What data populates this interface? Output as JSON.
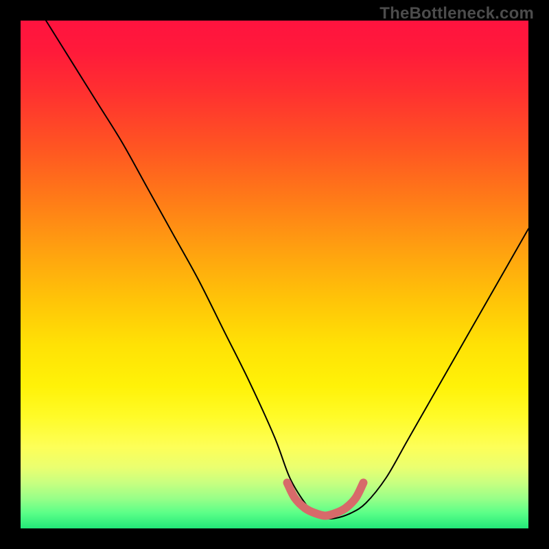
{
  "watermark": "TheBottleneck.com",
  "chart_data": {
    "type": "line",
    "title": "",
    "xlabel": "",
    "ylabel": "",
    "xlim": [
      0,
      100
    ],
    "ylim": [
      0,
      100
    ],
    "grid": false,
    "series": [
      {
        "name": "main-curve",
        "color": "#000000",
        "x": [
          5,
          10,
          15,
          20,
          25,
          30,
          35,
          40,
          45,
          50,
          53,
          56,
          58,
          60,
          62,
          65,
          68,
          72,
          76,
          80,
          84,
          88,
          92,
          96,
          100
        ],
        "y": [
          100,
          92,
          84,
          76,
          67,
          58,
          49,
          39,
          29,
          18,
          10,
          5,
          3,
          2,
          2,
          3,
          5,
          10,
          17,
          24,
          31,
          38,
          45,
          52,
          59
        ]
      },
      {
        "name": "optimal-band",
        "color": "#d76a6a",
        "x": [
          52.5,
          54,
          56,
          58,
          60,
          62,
          64,
          66,
          67.5
        ],
        "y": [
          9,
          6,
          4,
          3,
          2.5,
          3,
          4,
          6,
          9
        ]
      }
    ],
    "annotations": []
  }
}
